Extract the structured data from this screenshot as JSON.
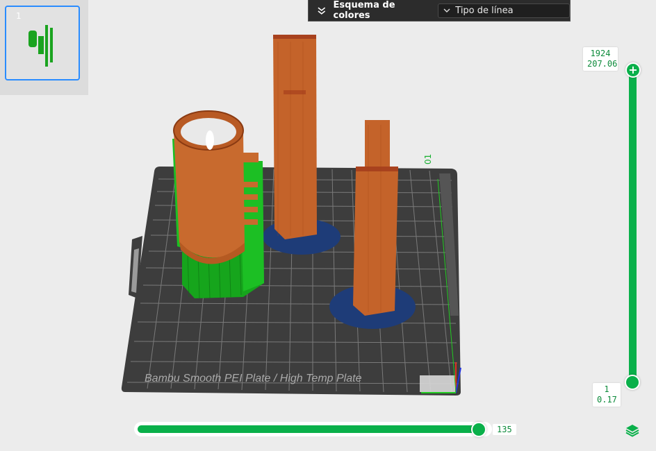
{
  "plate_list": {
    "number": "1"
  },
  "color_scheme": {
    "label": "Esquema de colores",
    "selected": "Tipo de línea"
  },
  "layer_slider": {
    "top_layer": "1924",
    "top_height": "207.06",
    "bottom_layer": "1",
    "bottom_height": "0.17"
  },
  "move_slider": {
    "value": "135"
  },
  "plate": {
    "name": "Bambu Smooth PEI Plate / High Temp Plate",
    "corner_label": "01"
  },
  "colors": {
    "accent": "#0ab04a",
    "wall": "#c8622a",
    "support": "#1fbd1f",
    "brim": "#1f3f7a",
    "bed": "#3a3a3a"
  }
}
